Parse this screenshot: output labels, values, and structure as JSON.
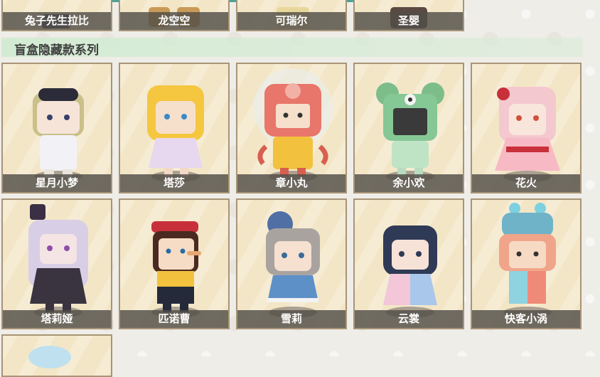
{
  "top_tabs": [
    {
      "color": "#4aa397"
    }
  ],
  "prev_row": [
    {
      "name": "兔子先生拉比"
    },
    {
      "name": "龙空空"
    },
    {
      "name": "可瑞尔"
    },
    {
      "name": "圣婴"
    }
  ],
  "section": {
    "title": "盲盒隐藏款系列"
  },
  "cards": [
    {
      "name": "星月小梦",
      "icon": "character-xingyuexiaomeng-icon"
    },
    {
      "name": "塔莎",
      "icon": "character-tasha-icon"
    },
    {
      "name": "章小丸",
      "icon": "character-zhangxiaowan-icon"
    },
    {
      "name": "余小欢",
      "icon": "character-yuxiaohuan-icon"
    },
    {
      "name": "花火",
      "icon": "character-huahuo-icon"
    },
    {
      "name": "塔莉娅",
      "icon": "character-taliya-icon"
    },
    {
      "name": "匹诺曹",
      "icon": "character-pinuocao-icon"
    },
    {
      "name": "雪莉",
      "icon": "character-xueli-icon"
    },
    {
      "name": "云裳",
      "icon": "character-yunshang-icon"
    },
    {
      "name": "快客小涡",
      "icon": "character-kuaikexiaowo-icon"
    }
  ],
  "colors": {
    "card_bg": "#f3e6c6",
    "card_border": "#a89476",
    "label_bg": "#524e48",
    "section_bg": "#d2ebd2",
    "accent": "#4aa397"
  }
}
